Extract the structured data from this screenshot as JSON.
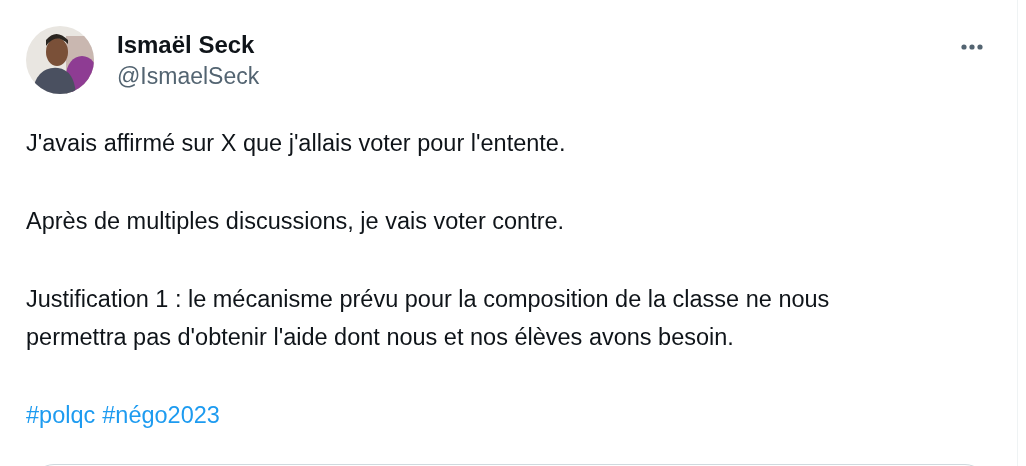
{
  "author": {
    "name": "Ismaël Seck",
    "handle": "@IsmaelSeck"
  },
  "paragraphs": [
    "J'avais affirmé sur X que j'allais voter pour l'entente.",
    "Après de multiples discussions, je vais voter contre.",
    "Justification 1 : le mécanisme prévu pour la composition de la classe ne nous permettra pas d'obtenir l'aide dont nous et nos élèves avons besoin."
  ],
  "hashtags": [
    "#polqc",
    "#négo2023"
  ]
}
